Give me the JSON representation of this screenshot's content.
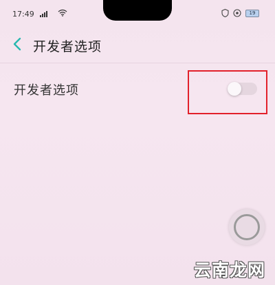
{
  "status_bar": {
    "time": "17:49",
    "battery": "19"
  },
  "header": {
    "back_icon": "chevron-left-icon",
    "title": "开发者选项"
  },
  "settings": {
    "developer_options": {
      "label": "开发者选项",
      "toggle_state": "off"
    }
  },
  "highlight": {
    "color": "#e2202a"
  },
  "watermark": {
    "text": "云南龙网"
  },
  "colors": {
    "background": "#f4e4ee",
    "accent_back": "#29b8b0"
  }
}
